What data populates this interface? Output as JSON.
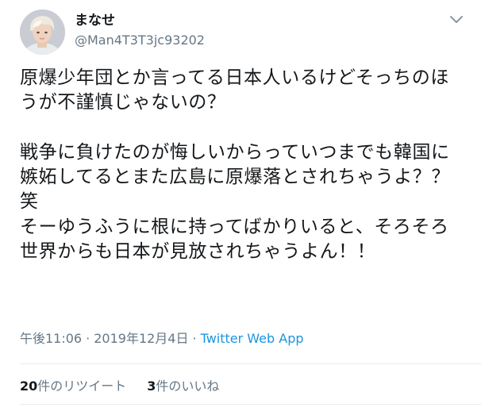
{
  "user": {
    "display_name": "まなせ",
    "handle": "@Man4T3T3jc93202"
  },
  "tweet": {
    "text": "原爆少年団とか言ってる日本人いるけどそっちのほうが不謹慎じゃないの？\n\n戦争に負けたのが悔しいからっていつまでも韓国に嫉妬してるとまた広島に原爆落とされちゃうよ？？笑\nそーゆうふうに根に持ってばかりいると、そろそろ世界からも日本が見放されちゃうよん！！",
    "time": "午後11:06",
    "date": "2019年12月4日",
    "separator": "·",
    "source": "Twitter Web App"
  },
  "stats": {
    "retweet_count": "20",
    "retweet_label": "件のリツイート",
    "like_count": "3",
    "like_label": "件のいいね"
  },
  "icons": {
    "menu": "chevron-down-icon",
    "avatar": "avatar"
  },
  "colors": {
    "text": "#14171a",
    "secondary": "#657786",
    "link": "#1b95e0",
    "divider": "#e6ecf0"
  }
}
